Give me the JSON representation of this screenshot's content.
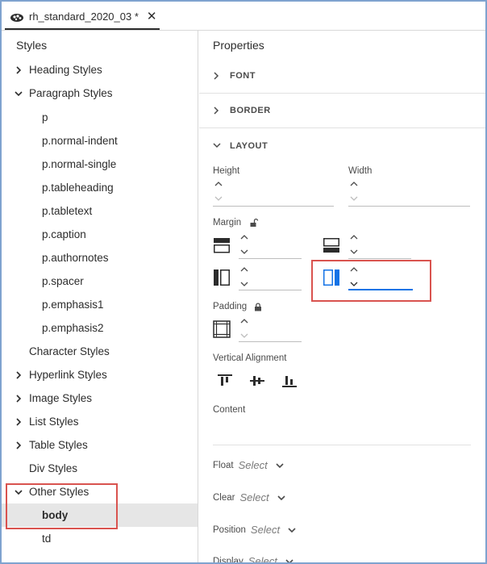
{
  "tab": {
    "title": "rh_standard_2020_03 *"
  },
  "styles_panel": {
    "title": "Styles",
    "items": [
      {
        "label": "Heading Styles",
        "state": "collapsed"
      },
      {
        "label": "Paragraph Styles",
        "state": "expanded"
      },
      {
        "label": "p"
      },
      {
        "label": "p.normal-indent"
      },
      {
        "label": "p.normal-single"
      },
      {
        "label": "p.tableheading"
      },
      {
        "label": "p.tabletext"
      },
      {
        "label": "p.caption"
      },
      {
        "label": "p.authornotes"
      },
      {
        "label": "p.spacer"
      },
      {
        "label": "p.emphasis1"
      },
      {
        "label": "p.emphasis2"
      },
      {
        "label": "Character Styles"
      },
      {
        "label": "Hyperlink Styles",
        "state": "collapsed"
      },
      {
        "label": "Image Styles",
        "state": "collapsed"
      },
      {
        "label": "List Styles",
        "state": "collapsed"
      },
      {
        "label": "Table Styles",
        "state": "collapsed"
      },
      {
        "label": "Div Styles"
      },
      {
        "label": "Other Styles",
        "state": "expanded"
      },
      {
        "label": "body",
        "selected": true
      },
      {
        "label": "td"
      }
    ]
  },
  "properties_panel": {
    "title": "Properties",
    "sections": {
      "font": "FONT",
      "border": "BORDER",
      "layout": "LAYOUT"
    },
    "height_label": "Height",
    "width_label": "Width",
    "margin_label": "Margin",
    "padding_label": "Padding",
    "vertical_alignment_label": "Vertical Alignment",
    "content_label": "Content",
    "float_label": "Float",
    "clear_label": "Clear",
    "position_label": "Position",
    "display_label": "Display",
    "select_placeholder": "Select"
  },
  "colors": {
    "accent": "#1473e6",
    "highlight": "#d9534f",
    "frame": "#7fa3cf"
  }
}
